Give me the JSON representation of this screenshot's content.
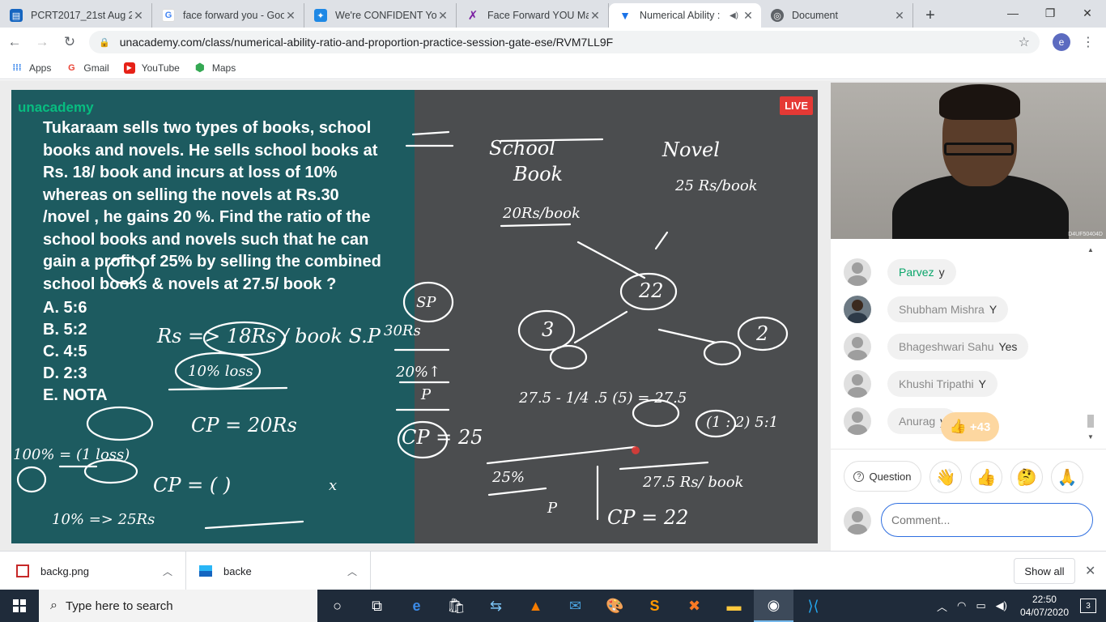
{
  "tabs": [
    {
      "title": "PCRT2017_21st Aug 20",
      "favicon": "document-icon",
      "color": "#1565c0"
    },
    {
      "title": "face forward you - Goo",
      "favicon": "google-icon",
      "color": "#4285f4"
    },
    {
      "title": "We're CONFIDENT You",
      "favicon": "puzzle-icon",
      "color": "#1e88e5"
    },
    {
      "title": "Face Forward YOU Man",
      "favicon": "x-logo-icon",
      "color": "#7b1fa2"
    },
    {
      "title": "Numerical Ability : ",
      "favicon": "unacademy-icon",
      "color": "#1a73e8",
      "active": true
    },
    {
      "title": "Document",
      "favicon": "globe-icon",
      "color": "#5f6368"
    }
  ],
  "address": {
    "url": "unacademy.com/class/numerical-ability-ratio-and-proportion-practice-session-gate-ese/RVM7LL9F",
    "profile_initial": "e"
  },
  "bookmarks": [
    {
      "label": "Apps",
      "icon": "apps-grid-icon"
    },
    {
      "label": "Gmail",
      "icon": "google-icon"
    },
    {
      "label": "YouTube",
      "icon": "youtube-icon"
    },
    {
      "label": "Maps",
      "icon": "maps-pin-icon"
    }
  ],
  "video": {
    "brand": "unacademy",
    "live_label": "LIVE",
    "question": "Tukaraam sells two types of books, school books and novels. He sells school books at Rs. 18/ book and incurs at loss of 10% whereas on selling the novels at Rs.30 /novel , he gains 20 %. Find the ratio of the school books and novels such that he can gain a profit of 25% by selling the combined school books & novels at 27.5/ book ?",
    "options": [
      "A. 5:6",
      "B. 5:2",
      "C. 4:5",
      "D. 2:3",
      "E. NOTA"
    ],
    "ink": {
      "school": "School",
      "book": "Book",
      "novel": "Novel",
      "school_price": "20Rs/book",
      "novel_price": "25 Rs/book",
      "n22": "22",
      "n3": "3",
      "n2": "2",
      "sp": "SP",
      "sp30": "30Rs",
      "pct20": "20%↑",
      "p": "P",
      "cp25": "CP = 25",
      "rs18": "Rs => 18Rs / book S.P",
      "loss10": "10% loss",
      "cp20": "CP = 20Rs",
      "loss_eq": "100% = (1 loss)",
      "eq_275": "27.5 - 1/4 .5 (5) = 27.5",
      "ratio": "(1 : 2) 5:1",
      "p25": "25%",
      "p_under": "P",
      "rs275": "27.5 Rs/ book",
      "cp22": "CP = 22",
      "cp_blank": "CP = ( )",
      "x": "x",
      "to25": "10% => 25Rs"
    }
  },
  "chat": [
    {
      "name": "Parvez",
      "text": "y",
      "highlight": true,
      "avatar": "avatar-icon"
    },
    {
      "name": "Shubham Mishra",
      "text": "Y",
      "avatar": "avatar-photo"
    },
    {
      "name": "Bhageshwari Sahu",
      "text": "Yes",
      "avatar": "avatar-icon"
    },
    {
      "name": "Khushi Tripathi",
      "text": "Y",
      "avatar": "avatar-icon"
    },
    {
      "name": "Anurag",
      "text": "y",
      "avatar": "avatar-icon"
    }
  ],
  "likes": {
    "count": "+43",
    "icon": "thumbs-up-icon"
  },
  "actions": {
    "question_label": "Question",
    "reactions": [
      "👋",
      "👍",
      "🤔",
      "🙏"
    ]
  },
  "comment": {
    "placeholder": "Comment..."
  },
  "downloads": [
    {
      "name": "backg.png"
    },
    {
      "name": "backe"
    }
  ],
  "downloads_show_all": "Show all",
  "taskbar": {
    "search_placeholder": "Type here to search",
    "time": "22:50",
    "date": "04/07/2020",
    "notifications": "3"
  }
}
